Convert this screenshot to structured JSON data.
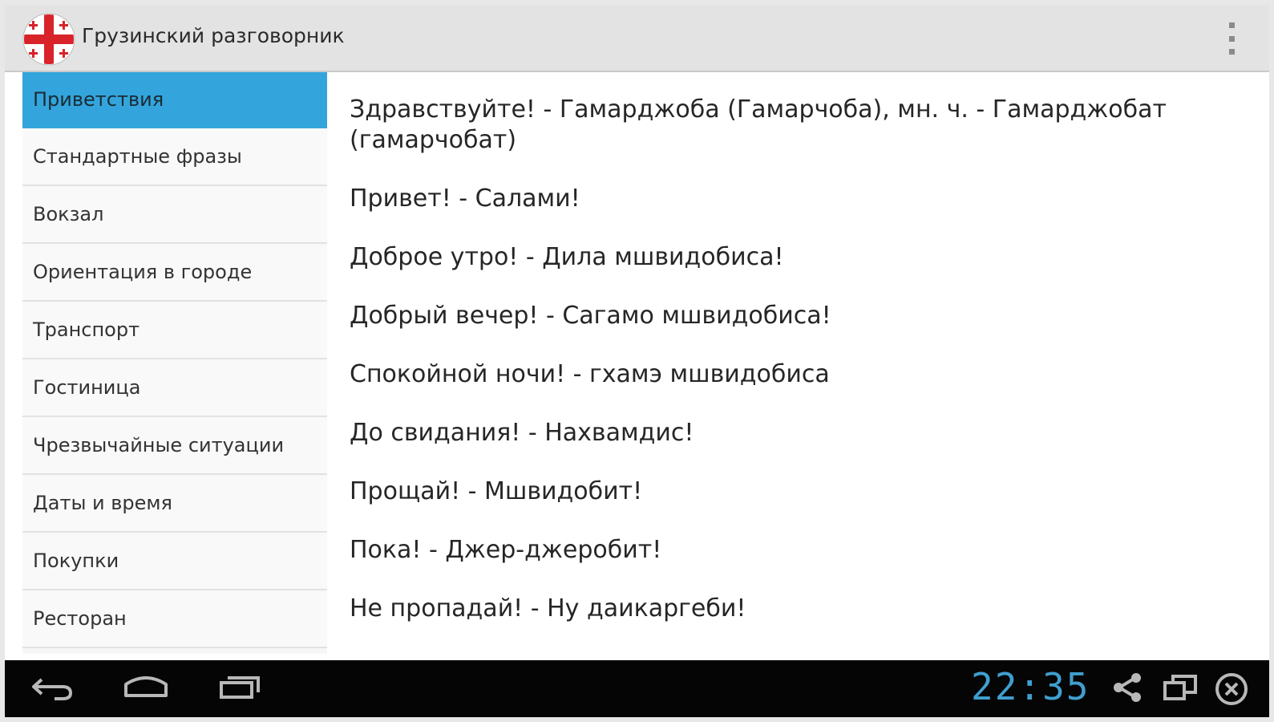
{
  "app": {
    "title": "Грузинский разговорник",
    "icon": "georgian-flag-icon",
    "overflow_icon": "overflow-menu-icon"
  },
  "sidebar": {
    "items": [
      {
        "label": "Приветствия",
        "selected": true
      },
      {
        "label": "Стандартные фразы"
      },
      {
        "label": "Вокзал"
      },
      {
        "label": "Ориентация в городе"
      },
      {
        "label": "Транспорт"
      },
      {
        "label": "Гостиница"
      },
      {
        "label": "Чрезвычайные ситуации"
      },
      {
        "label": "Даты и время"
      },
      {
        "label": "Покупки"
      },
      {
        "label": "Ресторан"
      }
    ]
  },
  "phrases": [
    "Здравствуйте! - Гамарджоба (Гамарчоба), мн. ч. - Гамарджобат (гамарчобат)",
    "Привет! - Салами!",
    "Доброе утро! - Дила мшвидобиса!",
    "Добрый вечер! - Сагамо мшвидобиса!",
    "Спокойной ночи! - гхамэ мшвидобиса",
    "До свидания! - Нахвамдис!",
    "Прощай! - Мшвидобит!",
    "Пока! - Джер-джеробит!",
    "Не пропадай! - Ну даикаргеби!"
  ],
  "system_bar": {
    "clock": "22:35",
    "icons": [
      "back-icon",
      "home-icon",
      "recent-apps-icon",
      "share-icon",
      "window-icon",
      "close-icon"
    ]
  },
  "colors": {
    "selected": "#33a5dc",
    "clock": "#3f9fcf"
  }
}
